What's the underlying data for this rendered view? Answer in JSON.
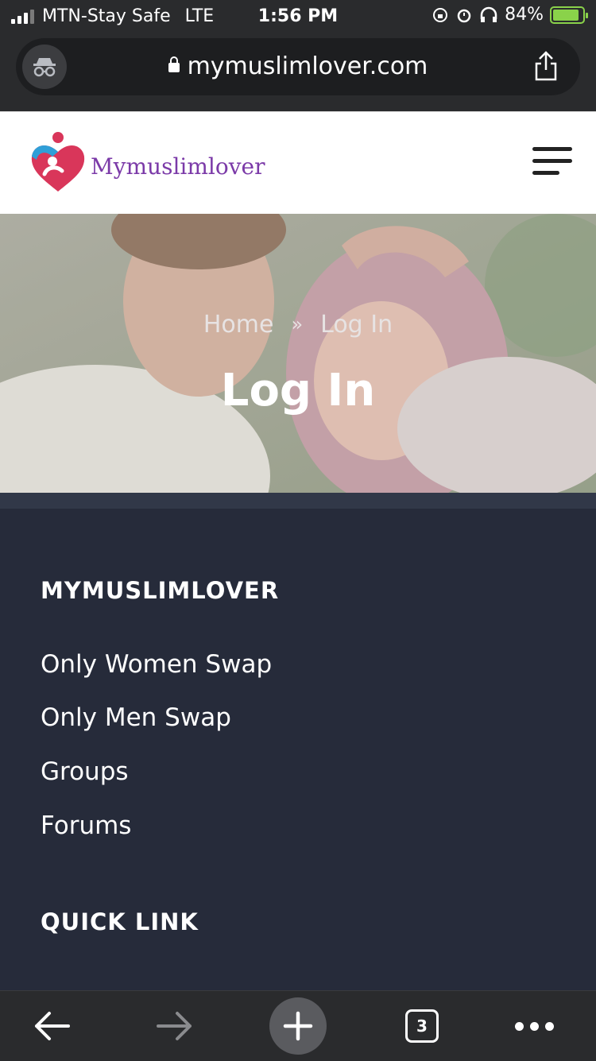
{
  "status_bar": {
    "carrier": "MTN-Stay Safe",
    "network": "LTE",
    "time": "1:56 PM",
    "battery": "84%"
  },
  "browser": {
    "url": "mymuslimlover.com",
    "tabs_count": "3"
  },
  "site": {
    "logo_text": "Mymuslimlover"
  },
  "hero": {
    "breadcrumb_home": "Home",
    "breadcrumb_separator": "»",
    "breadcrumb_current": "Log In",
    "title": "Log In"
  },
  "footer": {
    "section1_title": "MYMUSLIMLOVER",
    "links": [
      "Only Women Swap",
      "Only Men Swap",
      "Groups",
      "Forums"
    ],
    "section2_title": "QUICK LINK"
  },
  "colors": {
    "logo_purple": "#7b3aa8",
    "footer_bg": "#262b3a",
    "battery_green": "#8ad24a"
  }
}
